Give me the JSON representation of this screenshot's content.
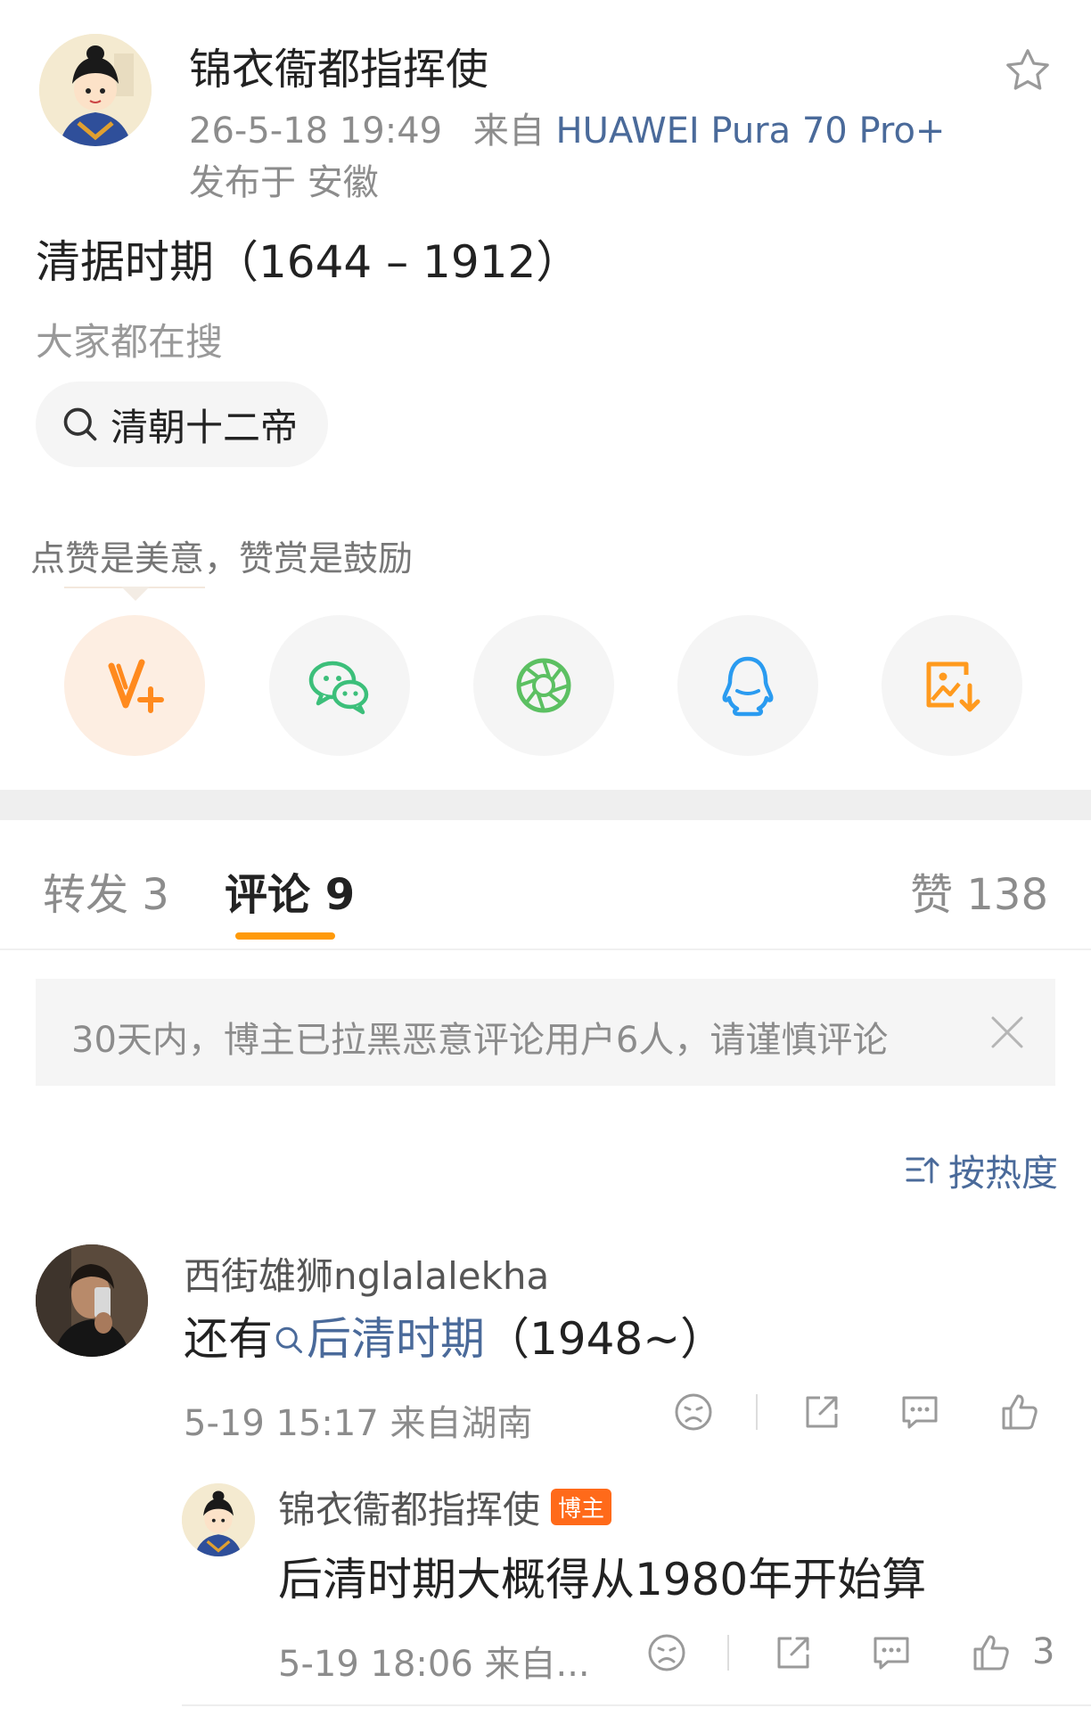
{
  "post": {
    "author_name": "锦衣衞都指挥使",
    "time": "26-5-18 19:49",
    "source_prefix": "来自",
    "device": "HUAWEI Pura 70 Pro+",
    "location": "发布于 安徽",
    "text": "清据时期（1644 – 1912）"
  },
  "search": {
    "label": "大家都在搜",
    "chip": "清朝十二帝"
  },
  "reward": {
    "tip": "点赞是美意，赞赏是鼓励"
  },
  "share_icons": [
    "v-plus-reward-icon",
    "wechat-icon",
    "moments-icon",
    "qq-icon",
    "save-image-icon"
  ],
  "tabs": {
    "repost": "转发 3",
    "comments": "评论 9",
    "likes": "赞 138"
  },
  "notice": {
    "text": "30天内，博主已拉黑恶意评论用户6人，请谨慎评论"
  },
  "sort": {
    "label": "按热度"
  },
  "comment": {
    "user": "西街雄狮nglalalekha",
    "text_prefix": "还有",
    "tag": "后清时期",
    "text_suffix": "（1948~）",
    "meta": "5-19 15:17  来自湖南"
  },
  "reply": {
    "user": "锦衣衞都指挥使",
    "badge": "博主",
    "text": "后清时期大概得从1980年开始算",
    "meta": "5-19 18:06  来自...",
    "likes": "3"
  },
  "colors": {
    "accent": "#ff9a0a",
    "link": "#4a6a9a",
    "muted": "#8c8c8c"
  }
}
